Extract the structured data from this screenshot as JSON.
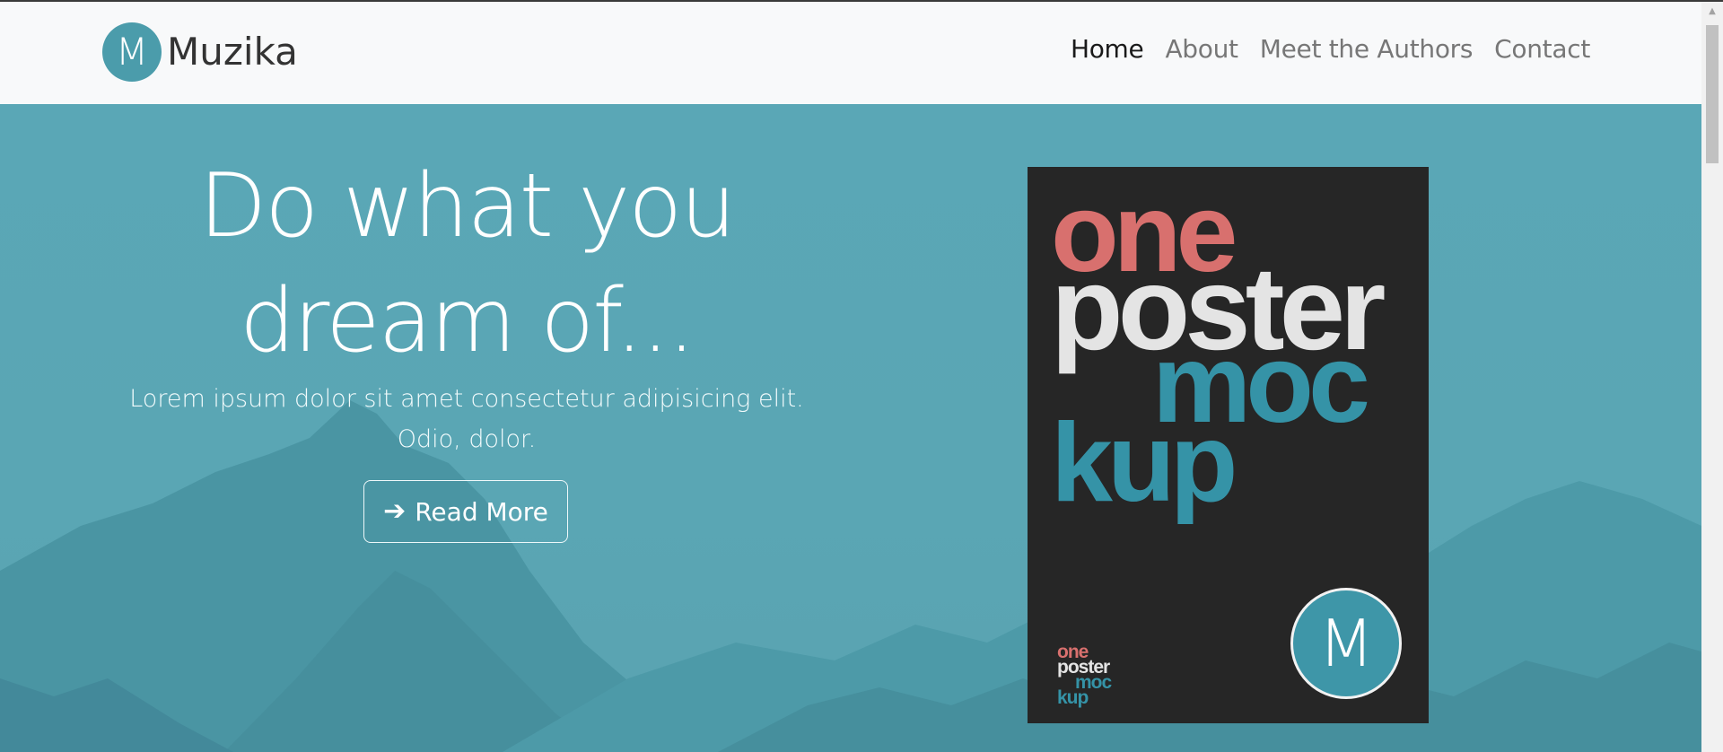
{
  "brand": {
    "logo_letter": "M",
    "name": "Muzika"
  },
  "nav": {
    "items": [
      {
        "label": "Home",
        "active": true
      },
      {
        "label": "About",
        "active": false
      },
      {
        "label": "Meet the Authors",
        "active": false
      },
      {
        "label": "Contact",
        "active": false
      }
    ]
  },
  "hero": {
    "title_line1": "Do what you",
    "title_line2": "dream of...",
    "text": "Lorem ipsum dolor sit amet consectetur adipisicing elit. Odio, dolor.",
    "button_label": "Read More",
    "button_icon": "arrow-right-icon"
  },
  "poster": {
    "words": [
      "one",
      "poster",
      "moc",
      "kup"
    ],
    "badge_letter": "M"
  },
  "colors": {
    "accent": "#4b9cab",
    "hero_bg": "#5aa6b4",
    "poster_bg": "#262626",
    "poster_red": "#d8706e",
    "poster_teal": "#3593a7"
  }
}
